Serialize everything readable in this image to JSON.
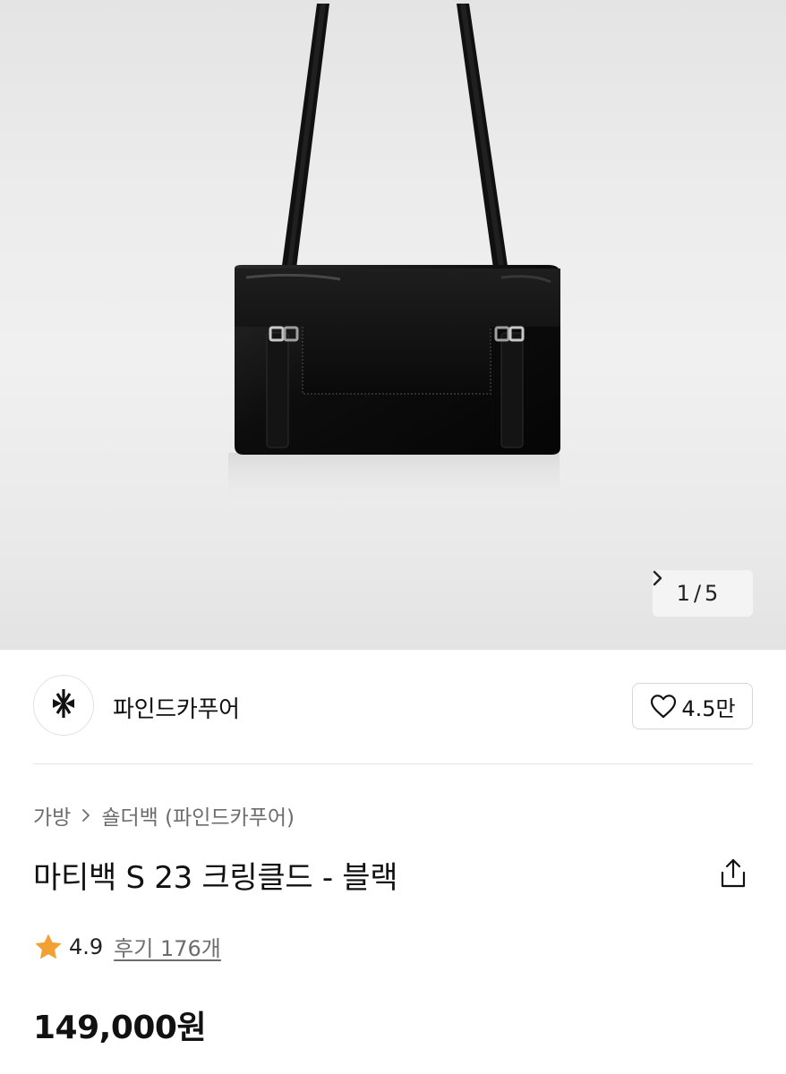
{
  "gallery": {
    "current": "1",
    "separator": "/",
    "total": "5"
  },
  "brand": {
    "name": "파인드카푸어",
    "likes": "4.5만"
  },
  "breadcrumb": {
    "items": [
      "가방",
      "숄더백 (파인드카푸어)"
    ]
  },
  "product": {
    "title": "마티백 S 23 크링클드 - 블랙",
    "rating": "4.9",
    "reviews": "후기 176개",
    "price": "149,000원"
  },
  "icons": {
    "pager_next": "chevron-right-icon",
    "brand_logo": "brand-logo-icon",
    "like": "heart-icon",
    "breadcrumb_sep": "chevron-right-icon",
    "share": "share-icon",
    "star": "star-icon"
  },
  "colors": {
    "star": "#F2A033",
    "text": "#111111",
    "muted": "#6D6D6D",
    "border": "#D7D7D7"
  }
}
